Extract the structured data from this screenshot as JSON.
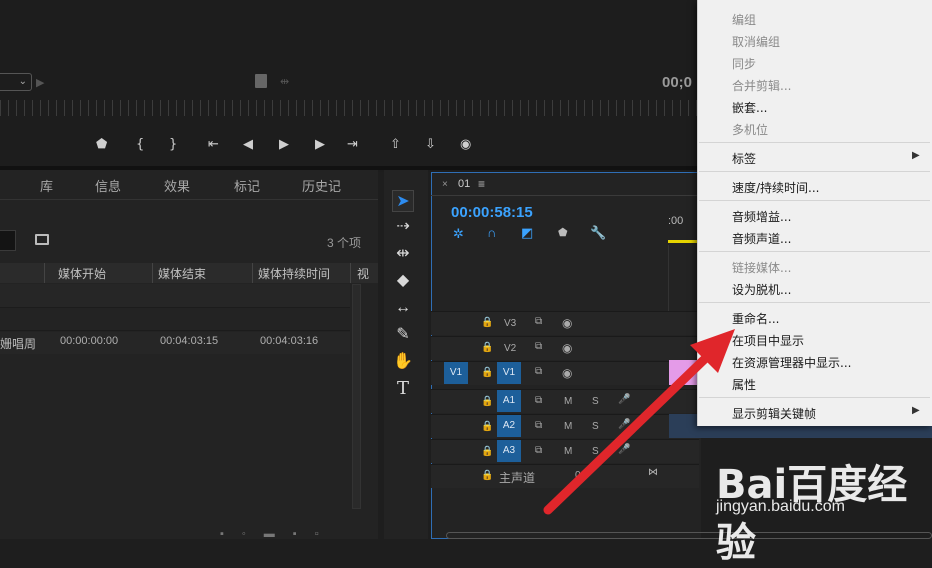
{
  "program_monitor": {
    "timecode": "00;0"
  },
  "project_panel": {
    "tabs": [
      "库",
      "信息",
      "效果",
      "标记",
      "历史记"
    ],
    "item_count": "3 个项",
    "columns": [
      "媒体开始",
      "媒体结束",
      "媒体持续时间",
      "视"
    ],
    "row": {
      "name": "姗唱周",
      "start": "00:00:00:00",
      "end": "00:04:03:15",
      "duration": "00:04:03:16"
    }
  },
  "timeline": {
    "sequence_name": "01",
    "timecode": "00:00:58:15",
    "ruler_label": ":00",
    "video_tracks": [
      "V3",
      "V2",
      "V1"
    ],
    "source_patch": "V1",
    "audio_tracks": [
      "A1",
      "A2",
      "A3"
    ],
    "mute_label": "M",
    "solo_label": "S",
    "master_label": "主声道",
    "master_value": "0.0"
  },
  "context_menu": {
    "items": [
      {
        "label": "编组",
        "enabled": false
      },
      {
        "label": "取消编组",
        "enabled": false
      },
      {
        "label": "同步",
        "enabled": false
      },
      {
        "label": "合并剪辑...",
        "enabled": false
      },
      {
        "label": "嵌套...",
        "enabled": true
      },
      {
        "label": "多机位",
        "enabled": false
      },
      {
        "label": "标签",
        "enabled": true
      },
      {
        "label": "速度/持续时间...",
        "enabled": true
      },
      {
        "label": "音频增益...",
        "enabled": true
      },
      {
        "label": "音频声道...",
        "enabled": true
      },
      {
        "label": "链接媒体...",
        "enabled": false
      },
      {
        "label": "设为脱机...",
        "enabled": true
      },
      {
        "label": "重命名...",
        "enabled": true
      },
      {
        "label": "在项目中显示",
        "enabled": true
      },
      {
        "label": "在资源管理器中显示...",
        "enabled": true
      },
      {
        "label": "属性",
        "enabled": true
      },
      {
        "label": "显示剪辑关键帧",
        "enabled": true
      }
    ]
  },
  "watermark": {
    "logo": "Bai百度经验",
    "url": "jingyan.baidu.com"
  },
  "colors": {
    "accent_blue": "#2f6eb5",
    "track_button": "#1d5f9a",
    "timecode_blue": "#3ba3ff",
    "arrow_red": "#e0262b",
    "clip_pink": "#e49be8"
  }
}
